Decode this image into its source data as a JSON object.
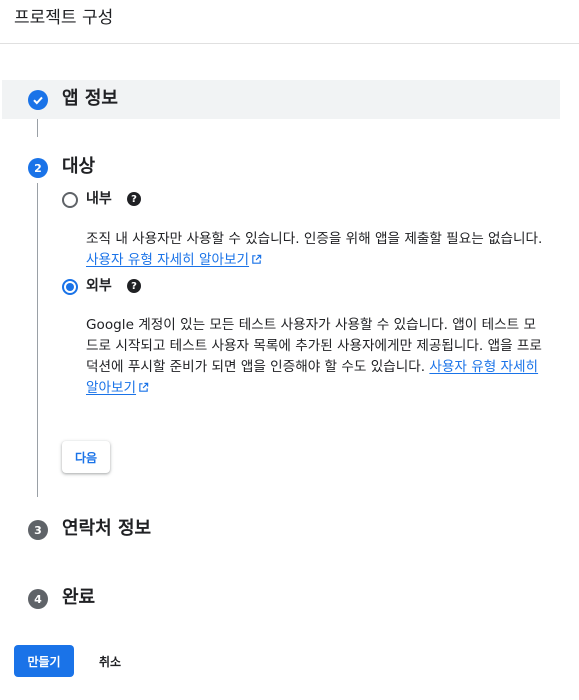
{
  "header": {
    "title": "프로젝트 구성"
  },
  "steps": [
    {
      "number": "1",
      "title": "앱 정보",
      "state": "completed"
    },
    {
      "number": "2",
      "title": "대상",
      "state": "active"
    },
    {
      "number": "3",
      "title": "연락처 정보",
      "state": "pending"
    },
    {
      "number": "4",
      "title": "완료",
      "state": "pending"
    }
  ],
  "audience": {
    "internal": {
      "label": "내부",
      "selected": false,
      "description": "조직 내 사용자만 사용할 수 있습니다. 인증을 위해 앱을 제출할 필요는 없습니다.",
      "link": "사용자 유형 자세히 알아보기"
    },
    "external": {
      "label": "외부",
      "selected": true,
      "description": "Google 계정이 있는 모든 테스트 사용자가 사용할 수 있습니다. 앱이 테스트 모드로 시작되고 테스트 사용자 목록에 추가된 사용자에게만 제공됩니다. 앱을 프로덕션에 푸시할 준비가 되면 앱을 인증해야 할 수도 있습니다.",
      "link": "사용자 유형 자세히 알아보기"
    },
    "next_label": "다음"
  },
  "footer": {
    "create_label": "만들기",
    "cancel_label": "취소"
  },
  "colors": {
    "accent": "#1a73e8",
    "inactive_step": "#5f6368",
    "completed_band": "#f1f3f4"
  },
  "icons": {
    "completed": "check-icon",
    "help": "help-icon",
    "external_link": "external-link-icon"
  }
}
